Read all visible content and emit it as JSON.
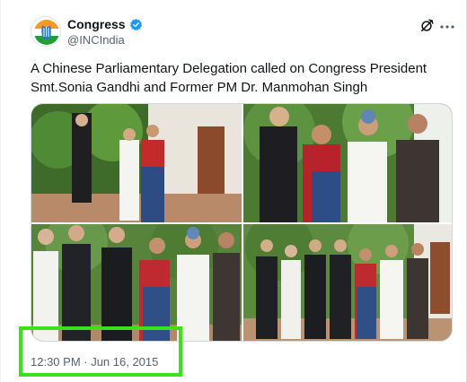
{
  "account": {
    "display_name": "Congress",
    "handle": "@INCIndia"
  },
  "tweet": {
    "text": "A Chinese Parliamentary Delegation called on Congress President Smt.Sonia Gandhi and Former PM Dr. Manmohan Singh",
    "timestamp": "12:30 PM · Jun 16, 2015"
  },
  "media": {
    "photo_count": 4
  },
  "colors": {
    "verified_badge": "#1d9bf0",
    "highlight": "#39e21a",
    "secondary_text": "#536471"
  },
  "icons": {
    "verified": "verified-badge-icon",
    "grok": "grok-icon",
    "more": "more-icon"
  }
}
